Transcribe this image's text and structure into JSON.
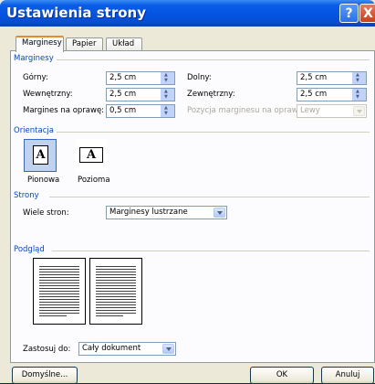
{
  "dialog": {
    "title": "Ustawienia strony",
    "help_label": "?",
    "close_label": "X"
  },
  "tabs": [
    {
      "label": "Marginesy",
      "active": true
    },
    {
      "label": "Papier",
      "active": false
    },
    {
      "label": "Układ",
      "active": false
    }
  ],
  "margins": {
    "group_label": "Marginesy",
    "top_label": "Górny:",
    "top_value": "2,5 cm",
    "bottom_label": "Dolny:",
    "bottom_value": "2,5 cm",
    "inner_label": "Wewnętrzny:",
    "inner_value": "2,5 cm",
    "outer_label": "Zewnętrzny:",
    "outer_value": "2,5 cm",
    "gutter_label": "Margines na oprawę:",
    "gutter_value": "0,5 cm",
    "gutter_pos_label": "Pozycja marginesu na oprawę:",
    "gutter_pos_value": "Lewy"
  },
  "orientation": {
    "group_label": "Orientacja",
    "portrait_label": "Pionowa",
    "landscape_label": "Pozioma",
    "icon_letter": "A",
    "selected": "portrait"
  },
  "pages": {
    "group_label": "Strony",
    "multiple_label": "Wiele stron:",
    "multiple_value": "Marginesy lustrzane"
  },
  "preview": {
    "group_label": "Podgląd",
    "apply_label": "Zastosuj do:",
    "apply_value": "Cały dokument"
  },
  "buttons": {
    "default_label": "Domyślne...",
    "ok_label": "OK",
    "cancel_label": "Anuluj"
  },
  "colors": {
    "group_label": "#0046d5",
    "titlebar": "#0453e0",
    "dialog_bg": "#ece9d8"
  }
}
